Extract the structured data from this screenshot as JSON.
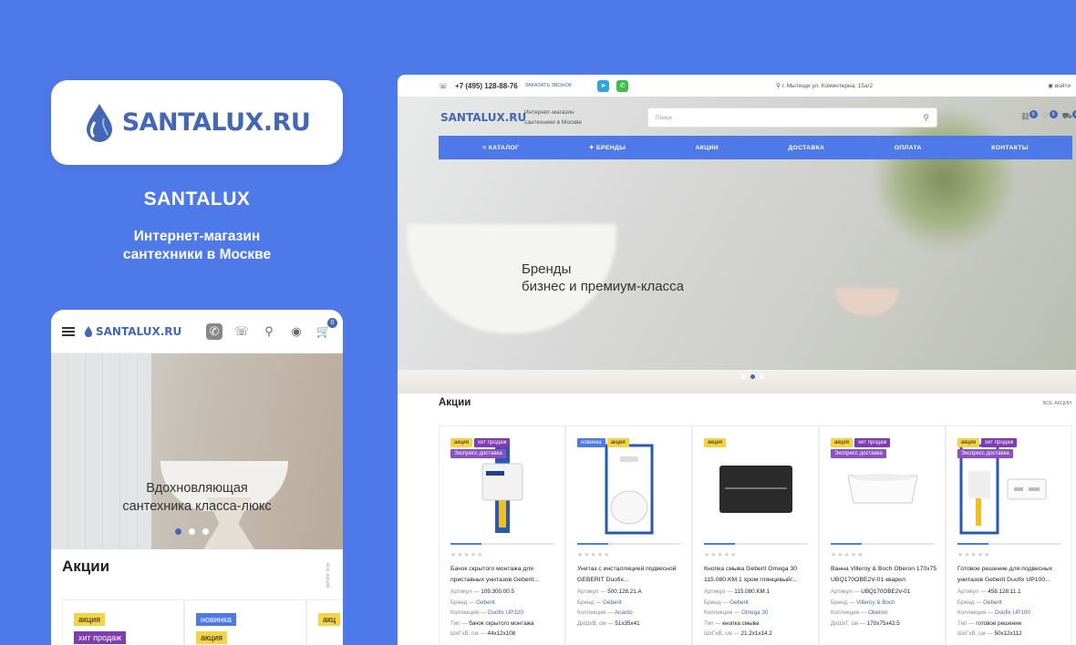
{
  "brand": {
    "logo_text": "SANTALUX.RU",
    "title": "SANTALUX",
    "subtitle_line1": "Интернет-магазин",
    "subtitle_line2": "сантехники в Москве",
    "colors": {
      "background": "#4e79e8",
      "accent": "#4367b5"
    }
  },
  "mobile": {
    "logo_text": "SANTALUX.RU",
    "cart_count": "0",
    "hero_line1": "Вдохновляющая",
    "hero_line2": "сантехника класса-люкс",
    "sale_title": "Акции",
    "side_text": "все акции",
    "cards": [
      {
        "tags": [
          "акция",
          "хит продаж"
        ]
      },
      {
        "tags": [
          "новинка",
          "акция"
        ]
      },
      {
        "tags": [
          "акц"
        ]
      }
    ]
  },
  "desktop": {
    "phone": "+7 (495) 128-88-76",
    "callback": "заказать звонок",
    "address": "г. Мытищи ул. Коминтерна, 15а/2",
    "login": "войти",
    "logo_text": "SANTALUX.RU",
    "tagline_line1": "Интернет-магазин",
    "tagline_line2": "сантехники в Москве",
    "search_placeholder": "Поиск",
    "compare_count": "0",
    "fav_count": "0",
    "cart_count": "0",
    "nav": [
      "Каталог",
      "Бренды",
      "Акции",
      "Доставка",
      "Оплата",
      "Контакты"
    ],
    "hero_line1": "Бренды",
    "hero_line2": "бизнес и премиум-класса",
    "sale_title": "Акции",
    "all_sales": "все акции",
    "labels": {
      "article": "Артикул",
      "brand": "Бренд",
      "collection": "Коллекция",
      "type": "Тип",
      "dims_a": "ШхГхВ, см",
      "dims_b": "ДхШхВ, см",
      "dims_c": "ДхШхГ, см"
    },
    "products": [
      {
        "tags_row1": [
          "акция",
          "хит продаж"
        ],
        "tags_row2": [
          "Экспресс доставка"
        ],
        "name": "Бачок скрытого монтажа для приставных унитазов Geberit...",
        "article": "109.300.00.5",
        "brand": "Geberit",
        "collection": "Duofix UP320",
        "type": "бачок скрытого монтажа",
        "dims_label": "ШхГхВ, см",
        "dims": "44x12x108",
        "icon": "concealed-cistern-icon"
      },
      {
        "tags_row1": [
          "новинка",
          "акция"
        ],
        "tags_row2": [],
        "name": "Унитаз с инсталляцией подвесной GEBERIT Duofix...",
        "article": "500.128.21.A",
        "brand": "Geberit",
        "collection": "Acanto",
        "type": "",
        "dims_label": "ДхШхВ, см",
        "dims": "51x35x41",
        "icon": "wall-hung-toilet-icon"
      },
      {
        "tags_row1": [
          "акция"
        ],
        "tags_row2": [],
        "name": "Кнопка смыва Geberit Omega 30 115.080.KM.1 хром глянцевый/...",
        "article": "115.080.KM.1",
        "brand": "Geberit",
        "collection": "Omega 30",
        "type": "кнопка смыва",
        "dims_label": "ШхГхВ, см",
        "dims": "21.2x1x14.2",
        "icon": "flush-button-icon"
      },
      {
        "tags_row1": [
          "акция",
          "хит продаж"
        ],
        "tags_row2": [
          "Экспресс доставка"
        ],
        "name": "Ванна Villeroy & Boch Oberon 170x75 UBQ170OBE2V-01 кварил",
        "article": "UBQ170OBE2V-01",
        "brand": "Villeroy & Boch",
        "collection": "Oberon",
        "type": "",
        "dims_label": "ДхШхГ, см",
        "dims": "170x75x42.5",
        "icon": "bathtub-icon"
      },
      {
        "tags_row1": [
          "акция",
          "хит продаж"
        ],
        "tags_row2": [
          "Экспресс доставка"
        ],
        "name": "Готовое решение для подвесных унитазов Geberit Duofix UP100...",
        "article": "458.128.11.1",
        "brand": "Geberit",
        "collection": "Duofix UP100",
        "type": "готовое решение",
        "dims_label": "ШхГхВ, см",
        "dims": "50x12x112",
        "icon": "installation-kit-icon"
      }
    ]
  }
}
